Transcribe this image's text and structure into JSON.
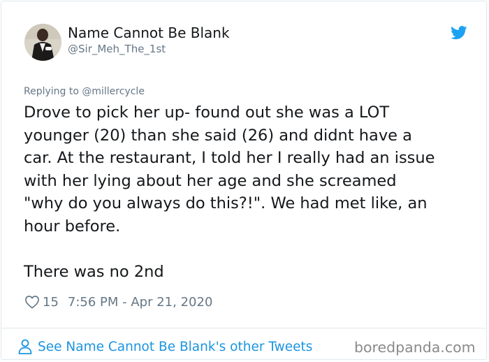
{
  "user": {
    "display_name": "Name Cannot Be Blank",
    "handle": "@Sir_Meh_The_1st"
  },
  "icons": {
    "platform": "twitter-bird-icon",
    "like": "heart-outline-icon",
    "profile": "person-outline-icon"
  },
  "colors": {
    "twitter_blue": "#1da1f2",
    "link_blue": "#1b95e0",
    "text": "#14171a",
    "secondary_text": "#657786",
    "divider": "#e1e8ed",
    "watermark": "#8a8a8a"
  },
  "tweet": {
    "replying_to": "Replying to @millercycle",
    "text_lines": [
      "Drove to pick her up- found out she was a LOT",
      "younger (20) than she said (26) and didnt have a",
      "car. At the restaurant, I told her I really had an issue",
      "with her lying about her age and she screamed",
      "\"why do you always do this?!\". We had met like, an",
      "hour before.",
      "There was no 2nd"
    ],
    "likes": "15",
    "timestamp": "7:56 PM - Apr 21, 2020"
  },
  "footer": {
    "link_text": "See Name Cannot Be Blank's other Tweets",
    "watermark": "boredpanda.com"
  }
}
